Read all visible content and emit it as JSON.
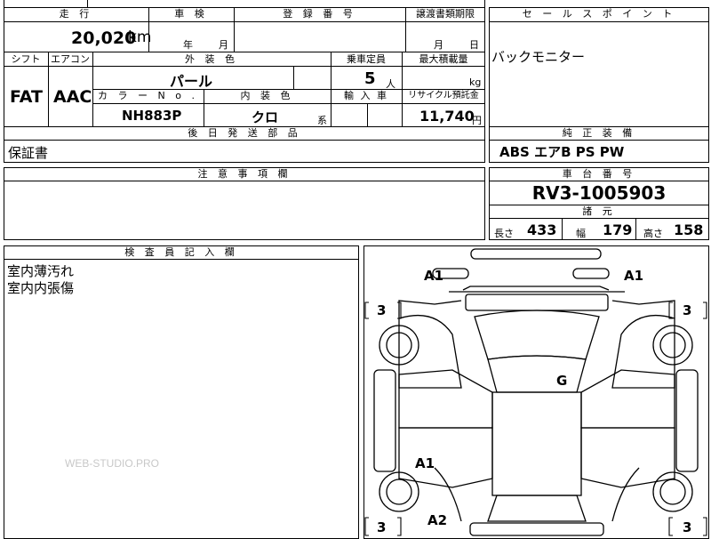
{
  "header": {
    "mileage_label": "走 行",
    "inspection_label": "車 検",
    "registration_label": "登 録 番 号",
    "transfer_label": "譲渡書類期限",
    "sales_point_label": "セ ー ル ス ポ イ ン ト",
    "mileage_value": "20,020",
    "mileage_unit": "km",
    "year_unit": "年",
    "month_unit": "月",
    "transfer_month_unit": "月",
    "transfer_day_unit": "日"
  },
  "specs": {
    "shift_label": "シフト",
    "aircon_label": "エアコン",
    "exterior_label": "外 装 色",
    "capacity_label": "乗車定員",
    "max_load_label": "最大積載量",
    "shift_value": "FAT",
    "aircon_value": "AAC",
    "exterior_value": "パール",
    "capacity_value": "5",
    "capacity_unit": "人",
    "load_unit": "kg",
    "color_no_label": "カ ラ ー N o .",
    "interior_label": "内 装 色",
    "import_label": "輸 入 車",
    "recycle_label": "リサイクル預託金",
    "color_no_value": "NH883P",
    "interior_value": "クロ",
    "interior_suffix": "系",
    "recycle_value": "11,740",
    "recycle_unit": "円"
  },
  "sales_point": {
    "text": "バックモニター"
  },
  "later_parts": {
    "label": "後 日 発 送 部 品",
    "value": "保証書"
  },
  "genuine_equipment": {
    "label": "純 正 装 備",
    "value": "ABS エアB PS PW"
  },
  "notes": {
    "label": "注 意 事 項 欄"
  },
  "chassis": {
    "label": "車 台 番 号",
    "value": "RV3-1005903",
    "dims_label": "諸 元",
    "length_label": "長さ",
    "length_value": "433",
    "width_label": "幅",
    "width_value": "179",
    "height_label": "高さ",
    "height_value": "158"
  },
  "inspector": {
    "label": "検 査 員 記 入 欄",
    "line1": "室内薄汚れ",
    "line2": "室内内張傷"
  },
  "watermark": "WEB-STUDIO.PRO",
  "diagram_marks": {
    "front_left": "A1",
    "front_right": "A1",
    "roof": "G",
    "rear_left_door": "A1",
    "rear_bumper": "A2",
    "left_top_bracket": "3",
    "right_top_bracket": "3",
    "left_bottom_bracket": "3",
    "right_bottom_bracket": "3"
  }
}
